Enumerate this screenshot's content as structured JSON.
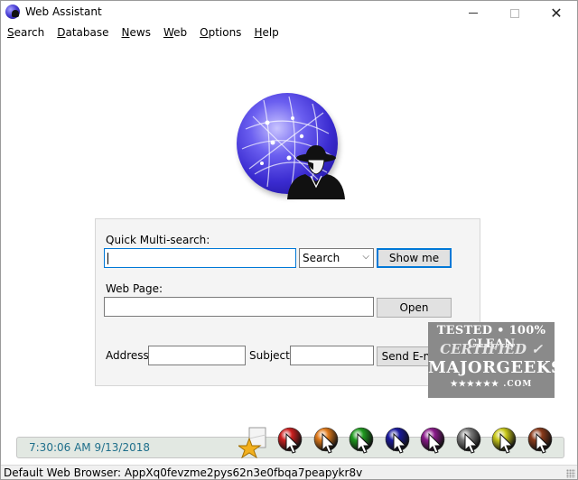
{
  "window": {
    "title": "Web Assistant",
    "close_symbol": "✕"
  },
  "menu": {
    "items": [
      {
        "accel": "S",
        "rest": "earch"
      },
      {
        "accel": "D",
        "rest": "atabase"
      },
      {
        "accel": "N",
        "rest": "ews"
      },
      {
        "accel": "W",
        "rest": "eb"
      },
      {
        "accel": "O",
        "rest": "ptions"
      },
      {
        "accel": "H",
        "rest": "elp"
      }
    ]
  },
  "form": {
    "quick_label": "Quick Multi-search:",
    "quick_value": "",
    "search_select": "Search",
    "show_me": "Show me",
    "web_page_label": "Web Page:",
    "web_page_value": "",
    "open": "Open",
    "address_label": "Address:",
    "address_value": "",
    "subject_label": "Subject:",
    "subject_value": "",
    "send_email": "Send E-mail"
  },
  "watermark": {
    "line1": "TESTED • 100% CLEAN",
    "line2": "CERTIFIED ✓",
    "line3": "MAJORGEEKS",
    "line4": "★★★★★★ .COM"
  },
  "clock": "7:30:06 AM 9/13/2018",
  "launchers": {
    "colors": [
      "#cc1f1f",
      "#e07a1a",
      "#1f9a1f",
      "#1a1a9e",
      "#8a1a8a",
      "#7a7a7a",
      "#c9c91a",
      "#8a3a1a"
    ],
    "icons": [
      "red-cursor-icon",
      "orange-cursor-icon",
      "green-cursor-icon",
      "blue-cursor-icon",
      "purple-cursor-icon",
      "gray-cursor-icon",
      "yellow-cursor-icon",
      "brown-cursor-icon"
    ]
  },
  "status": {
    "text": "Default Web Browser: AppXq0fevzme2pys62n3e0fbqa7peapykr8v"
  }
}
